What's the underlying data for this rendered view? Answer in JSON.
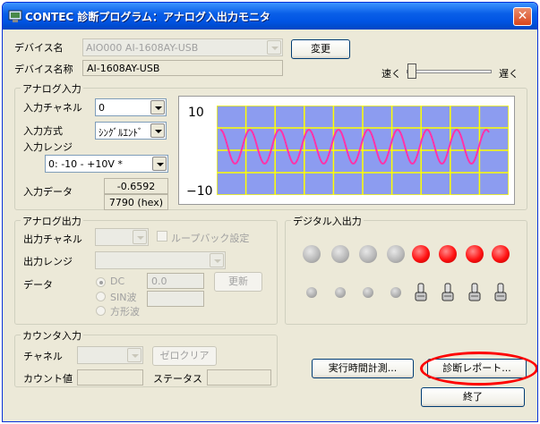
{
  "window": {
    "title": "CONTEC 診断プログラム：アナログ入出力モニタ"
  },
  "device": {
    "name_label": "デバイス名",
    "name_value": "AIO000  AI-1608AY-USB",
    "change_button": "変更",
    "model_label": "デバイス名称",
    "model_value": "AI-1608AY-USB"
  },
  "speed": {
    "fast_label": "速く",
    "slow_label": "遅く"
  },
  "analog_input": {
    "group_title": "アナログ入力",
    "channel_label": "入力チャネル",
    "channel_value": "0",
    "mode_label": "入力方式",
    "mode_value": "ｼﾝｸﾞﾙｴﾝﾄﾞ",
    "range_label": "入力レンジ",
    "range_value": "0: -10 - +10V *",
    "data_label": "入力データ",
    "data_value": "-0.6592",
    "data_hex": "7790 (hex)"
  },
  "plot": {
    "y_top": "10",
    "y_bottom": "−10",
    "background": "#8c9cf0",
    "grid": "#ffff00",
    "wave": "#ff33aa"
  },
  "analog_output": {
    "group_title": "アナログ出力",
    "channel_label": "出力チャネル",
    "loopback_label": "ループバック設定",
    "range_label": "出力レンジ",
    "data_label": "データ",
    "dc_label": "DC",
    "dc_value": "0.0",
    "update_button": "更新",
    "sin_label": "SIN波",
    "square_label": "方形波"
  },
  "digital_io": {
    "group_title": "デジタル入出力",
    "output_leds": [
      "off",
      "off",
      "off",
      "off",
      "on",
      "on",
      "on",
      "on"
    ]
  },
  "counter": {
    "group_title": "カウンタ入力",
    "channel_label": "チャネル",
    "zero_clear_button": "ゼロクリア",
    "count_label": "カウント値",
    "status_label": "ステータス"
  },
  "buttons": {
    "runtime_measure": "実行時間計測...",
    "diag_report": "診断レポート...",
    "exit": "終了"
  }
}
